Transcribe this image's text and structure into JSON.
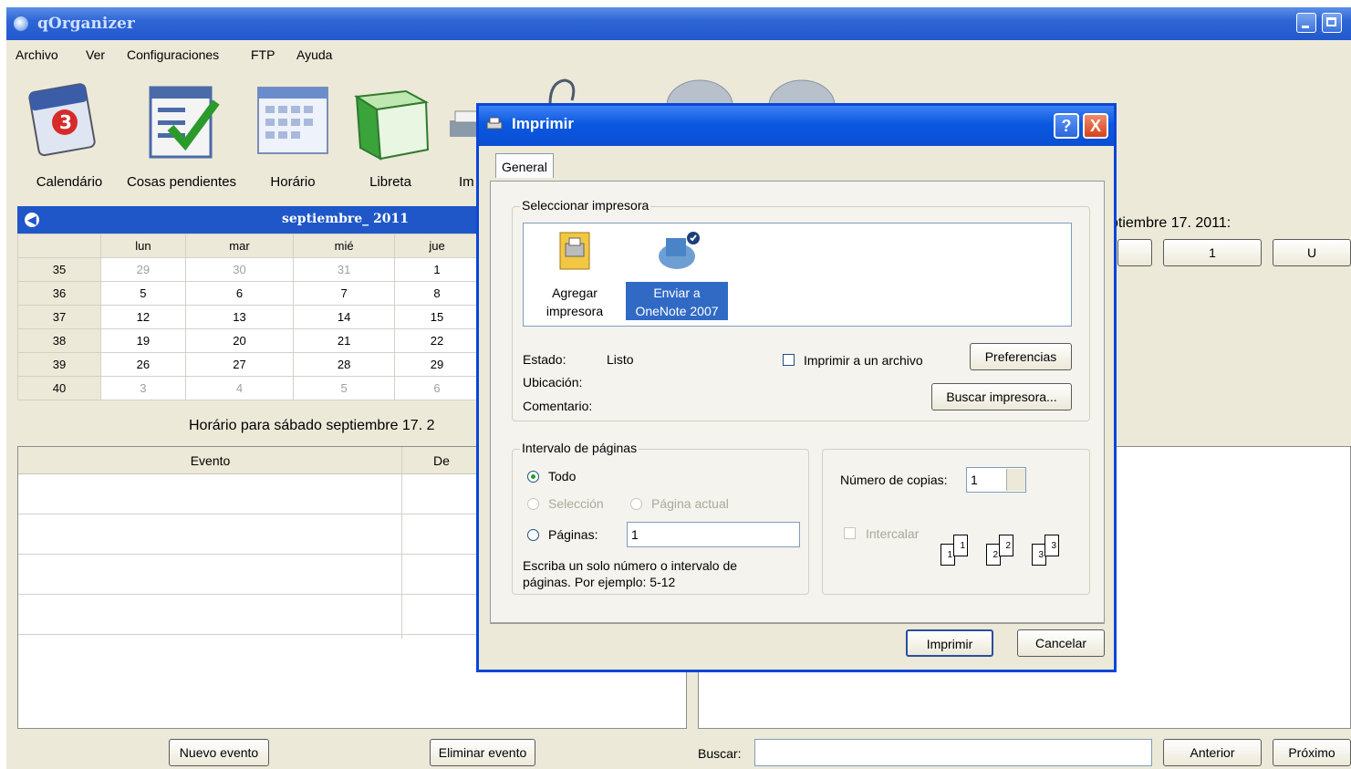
{
  "app": {
    "title": "qOrganizer"
  },
  "menu": [
    "Archivo",
    "Ver",
    "Configuraciones",
    "FTP",
    "Ayuda"
  ],
  "toolbar": {
    "items": [
      {
        "label": "Calendário",
        "icon": "calendar-icon"
      },
      {
        "label": "Cosas pendientes",
        "icon": "todo-list-icon"
      },
      {
        "label": "Horário",
        "icon": "schedule-icon"
      },
      {
        "label": "Libreta",
        "icon": "notebook-icon"
      },
      {
        "label": "Im",
        "icon": "printer-icon"
      }
    ]
  },
  "calendar": {
    "month_label": "septiembre_  2011",
    "weekday_headers": [
      "lun",
      "mar",
      "mié",
      "jue"
    ],
    "weeks": [
      {
        "week": "35",
        "days": [
          "29",
          "30",
          "31",
          "1"
        ]
      },
      {
        "week": "36",
        "days": [
          "5",
          "6",
          "7",
          "8"
        ]
      },
      {
        "week": "37",
        "days": [
          "12",
          "13",
          "14",
          "15"
        ]
      },
      {
        "week": "38",
        "days": [
          "19",
          "20",
          "21",
          "22"
        ]
      },
      {
        "week": "39",
        "days": [
          "26",
          "27",
          "28",
          "29"
        ]
      },
      {
        "week": "40",
        "days": [
          "3",
          "4",
          "5",
          "6"
        ]
      }
    ]
  },
  "schedule": {
    "title": "Horário para sábado septiembre 17. 2",
    "columns": [
      "Evento",
      "De"
    ],
    "new_event": "Nuevo evento",
    "delete_event": "Eliminar evento"
  },
  "right_panel": {
    "date_title": "ptiembre 17. 2011:",
    "buttons": [
      "1",
      "U"
    ],
    "search_label": "Buscar:",
    "prev": "Anterior",
    "next": "Próximo"
  },
  "dialog": {
    "title": "Imprimir",
    "help": "?",
    "close": "X",
    "tab": "General",
    "select_printer_label": "Seleccionar impresora",
    "printers": [
      {
        "label_line1": "Agregar",
        "label_line2": "impresora"
      },
      {
        "label_line1": "Enviar a",
        "label_line2": "OneNote 2007"
      }
    ],
    "status_label": "Estado:",
    "status_value": "Listo",
    "location_label": "Ubicación:",
    "comment_label": "Comentario:",
    "print_to_file": "Imprimir a un archivo",
    "preferences": "Preferencias",
    "find_printer": "Buscar impresora...",
    "page_range_label": "Intervalo de páginas",
    "all": "Todo",
    "selection": "Selección",
    "current_page": "Página actual",
    "pages": "Páginas:",
    "pages_value": "1",
    "hint_line1": "Escriba un solo número o intervalo de",
    "hint_line2": "páginas. Por ejemplo: 5-12",
    "copies_label": "Número de copias:",
    "copies_value": "1",
    "collate": "Intercalar",
    "print": "Imprimir",
    "cancel": "Cancelar"
  },
  "colors": {
    "titlebar": "#2258cc",
    "dialog_border": "#0a46d8",
    "calendar_header": "#1f57c8",
    "window_bg": "#ece9d8"
  }
}
